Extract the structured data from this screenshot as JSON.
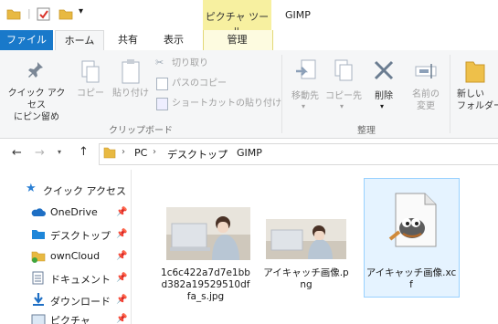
{
  "window": {
    "title": "GIMP",
    "contextual_tab_group": "ピクチャ ツール"
  },
  "tabs": [
    {
      "label": "ファイル"
    },
    {
      "label": "ホーム"
    },
    {
      "label": "共有"
    },
    {
      "label": "表示"
    },
    {
      "label": "管理"
    }
  ],
  "ribbon": {
    "pin_quick_access": "クイック アクセス\nにピン留め",
    "copy": "コピー",
    "paste": "貼り付け",
    "cut": "切り取り",
    "copy_path": "パスのコピー",
    "paste_shortcut": "ショートカットの貼り付け",
    "clipboard_group": "クリップボード",
    "move_to": "移動先",
    "copy_to": "コピー先",
    "delete": "削除",
    "rename": "名前の\n変更",
    "new_folder": "新しい\nフォルダー",
    "organize_group": "整理"
  },
  "address": {
    "crumbs": [
      "PC",
      "デスクトップ",
      "GIMP"
    ]
  },
  "nav_pane": {
    "items": [
      {
        "label": "クイック アクセス",
        "icon": "star-icon"
      },
      {
        "label": "OneDrive",
        "icon": "cloud-icon",
        "pinned": true
      },
      {
        "label": "デスクトップ",
        "icon": "desktop-folder-icon",
        "pinned": true
      },
      {
        "label": "ownCloud",
        "icon": "folder-icon",
        "pinned": true
      },
      {
        "label": "ドキュメント",
        "icon": "documents-icon",
        "pinned": true
      },
      {
        "label": "ダウンロード",
        "icon": "download-icon",
        "pinned": true
      },
      {
        "label": "ピクチャ",
        "icon": "pictures-icon",
        "pinned": true
      }
    ]
  },
  "files": [
    {
      "name": "1c6c422a7d7e1bbd382a19529510dffa_s.jpg",
      "type": "image",
      "selected": false
    },
    {
      "name": "アイキャッチ画像.png",
      "type": "image",
      "selected": false
    },
    {
      "name": "アイキャッチ画像.xcf",
      "type": "gimp",
      "selected": true
    }
  ],
  "colors": {
    "file_tab": "#1979ca",
    "contextual_tab": "#f7f0a0",
    "selection": "#e5f3ff",
    "selection_border": "#99d1ff"
  }
}
